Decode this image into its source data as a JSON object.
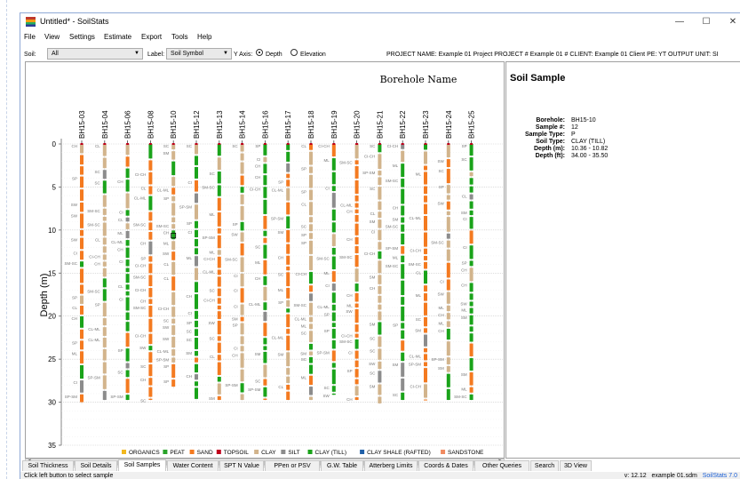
{
  "window": {
    "title": "Untitled* - SoilStats",
    "minimize": "—",
    "maximize": "☐",
    "close": "✕"
  },
  "menu": [
    "File",
    "View",
    "Settings",
    "Estimate",
    "Export",
    "Tools",
    "Help"
  ],
  "toolbar": {
    "soil_label": "Soil:",
    "soil_value": "All",
    "label_label": "Label:",
    "label_value": "Soil Symbol",
    "yaxis_label": "Y Axis:",
    "yaxis_options": [
      "Depth",
      "Elevation"
    ],
    "yaxis_selected": "Depth",
    "project_info": "PROJECT NAME: Example 01 Project   PROJECT # Example 01 #   CLIENT: Example 01 Client   PE: YT   OUTPUT UNIT: SI"
  },
  "chart_data": {
    "type": "strip",
    "title": "Borehole Name",
    "ylabel": "Depth (m)",
    "ylim": [
      0,
      35
    ],
    "yticks": [
      0,
      5,
      10,
      15,
      20,
      25,
      30,
      35
    ],
    "boreholes": [
      "BH15-03",
      "BH15-04",
      "BH15-06",
      "BH15-08",
      "BH15-10",
      "BH15-12",
      "BH15-13",
      "BH15-14",
      "BH15-16",
      "BH15-17",
      "BH15-18",
      "BH15-19",
      "BH15-20",
      "BH15-21",
      "BH15-22",
      "BH15-23",
      "BH15-24",
      "BH15-25"
    ],
    "max_depth": [
      30.2,
      29.8,
      29.8,
      29.8,
      28.4,
      29.8,
      29.8,
      29.8,
      29.8,
      29.8,
      29.8,
      29.2,
      29.8,
      30.2,
      29.8,
      29.8,
      29.8,
      29.8
    ],
    "legend": [
      {
        "name": "ORGANICS",
        "color": "#f2b81e"
      },
      {
        "name": "PEAT",
        "color": "#29a329"
      },
      {
        "name": "SAND",
        "color": "#f47a20"
      },
      {
        "name": "TOPSOIL",
        "color": "#c0001c"
      },
      {
        "name": "CLAY",
        "color": "#d2b48c"
      },
      {
        "name": "SILT",
        "color": "#8c8c8c"
      },
      {
        "name": "CLAY (TILL)",
        "color": "#1aa31a"
      },
      {
        "name": "CLAY SHALE (RAFTED)",
        "color": "#1f5fa8"
      },
      {
        "name": "SANDSTONE",
        "color": "#f08a60"
      }
    ]
  },
  "sample": {
    "title": "Soil Sample",
    "fields": [
      {
        "key": "Borehole:",
        "value": "BH15-10"
      },
      {
        "key": "Sample #:",
        "value": "12"
      },
      {
        "key": "Sample Type:",
        "value": "P"
      },
      {
        "key": "Soil Type:",
        "value": "CLAY (TILL)"
      },
      {
        "key": "Depth (m):",
        "value": "10.36 - 10.82"
      },
      {
        "key": "Depth (ft):",
        "value": "34.00 - 35.50"
      }
    ]
  },
  "tabs": [
    "Soil Thickness",
    "Soil Details",
    "Soil Samples",
    "Water Content",
    "SPT N Value",
    "PPen or PSV",
    "G.W. Table",
    "Atterberg Limits",
    "Coords & Dates",
    "Other Queries",
    "Search",
    "3D View"
  ],
  "active_tab": "Soil Samples",
  "status": {
    "left": "Click left button to select sample",
    "version": "v: 12.12",
    "file": "example 01.sdm",
    "product": "SoilStats 7.0"
  }
}
